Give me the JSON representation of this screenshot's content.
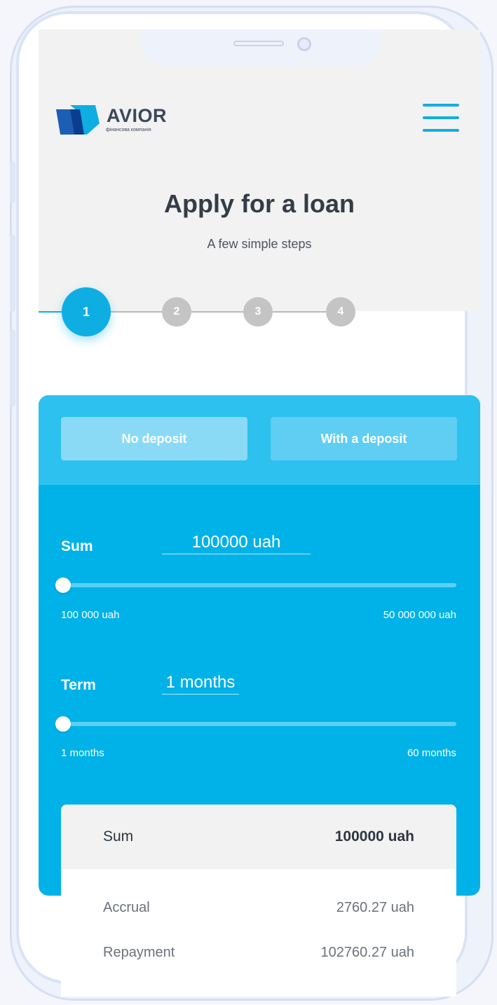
{
  "brand": {
    "name": "AVIOR",
    "tagline": "фінансова компанія",
    "color_primary": "#0eaee3",
    "color_dark": "#3b4859"
  },
  "header": {
    "menu_icon": "hamburger-icon"
  },
  "page": {
    "title": "Apply for a loan",
    "subtitle": "A few simple steps"
  },
  "stepper": {
    "current": 1,
    "steps": [
      "1",
      "2",
      "3",
      "4"
    ]
  },
  "deposit_tabs": {
    "no_deposit": "No deposit",
    "with_deposit": "With a deposit"
  },
  "calculator": {
    "sum": {
      "label": "Sum",
      "value": "100000 uah",
      "min_label": "100 000 uah",
      "max_label": "50 000 000 uah",
      "slider_fraction": 0
    },
    "term": {
      "label": "Term",
      "value": "1 months",
      "min_label": "1 months",
      "max_label": "60 months",
      "slider_fraction": 0
    }
  },
  "summary": {
    "sum_label": "Sum",
    "sum_value": "100000 uah",
    "accrual_label": "Accrual",
    "accrual_value": "2760.27 uah",
    "repayment_label": "Repayment",
    "repayment_value": "102760.27 uah"
  }
}
